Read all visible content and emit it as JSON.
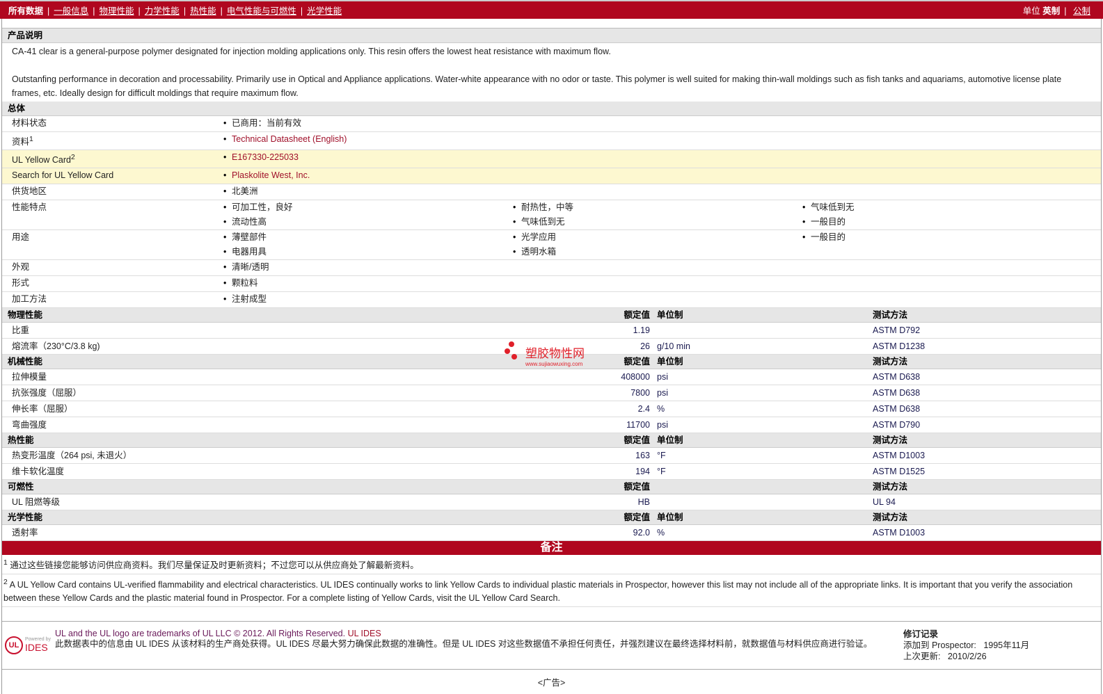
{
  "nav": {
    "active": "所有数据",
    "links": [
      "一般信息",
      "物理性能",
      "力学性能",
      "热性能",
      "电气性能与可燃性",
      "光学性能"
    ],
    "unit_label": "单位",
    "unit_english": "英制",
    "unit_metric": "公制"
  },
  "description": {
    "title": "产品说明",
    "p1": "CA-41 clear is a general-purpose polymer designated for injection molding applications only. This resin offers the lowest heat resistance with maximum flow.",
    "p2": "Outstanfing performance in decoration and processability. Primarily use in Optical and Appliance applications. Water-white appearance with no odor or taste. This polymer is well suited for making thin-wall moldings such as fish tanks and aquariams, automotive license plate frames, etc. Ideally design for difficult moldings that require maximum flow."
  },
  "general": {
    "title": "总体",
    "rows": [
      {
        "label": "材料状态",
        "values": [
          "已商用：当前有效"
        ]
      },
      {
        "label": "资料",
        "sup": "1",
        "values": [
          "Technical Datasheet (English)"
        ],
        "link": true
      },
      {
        "label": "UL Yellow Card",
        "sup": "2",
        "values": [
          "E167330-225033"
        ],
        "link": true,
        "yellow": true
      },
      {
        "label": "Search for UL Yellow Card",
        "values": [
          "Plaskolite West, Inc."
        ],
        "link": true,
        "yellow": true
      },
      {
        "label": "供货地区",
        "values": [
          "北美洲"
        ]
      },
      {
        "label": "性能特点",
        "values": [
          "可加工性，良好",
          "耐热性，中等",
          "气味低到无",
          "流动性高",
          "气味低到无",
          "一般目的"
        ]
      },
      {
        "label": "用途",
        "values": [
          "薄壁部件",
          "光学应用",
          "一般目的",
          "电器用具",
          "透明水箱"
        ]
      },
      {
        "label": "外观",
        "values": [
          "清晰/透明"
        ]
      },
      {
        "label": "形式",
        "values": [
          "颗粒料"
        ]
      },
      {
        "label": "加工方法",
        "values": [
          "注射成型"
        ]
      }
    ]
  },
  "headers": {
    "nominal": "额定值",
    "unit": "单位制",
    "test": "测试方法"
  },
  "sections": [
    {
      "title": "物理性能",
      "unit": true,
      "rows": [
        [
          "比重",
          "1.19",
          "",
          "ASTM D792"
        ],
        [
          "熔流率（230°C/3.8 kg)",
          "26",
          "g/10 min",
          "ASTM D1238"
        ]
      ]
    },
    {
      "title": "机械性能",
      "unit": true,
      "rows": [
        [
          "拉伸模量",
          "408000",
          "psi",
          "ASTM D638"
        ],
        [
          "抗张强度（屈服）",
          "7800",
          "psi",
          "ASTM D638"
        ],
        [
          "伸长率（屈服）",
          "2.4",
          "%",
          "ASTM D638"
        ],
        [
          "弯曲强度",
          "11700",
          "psi",
          "ASTM D790"
        ]
      ]
    },
    {
      "title": "热性能",
      "unit": true,
      "rows": [
        [
          "热变形温度（264 psi, 未退火）",
          "163",
          "°F",
          "ASTM D1003"
        ],
        [
          "维卡软化温度",
          "194",
          "°F",
          "ASTM D1525"
        ]
      ]
    },
    {
      "title": "可燃性",
      "unit": false,
      "rows": [
        [
          "UL 阻燃等级",
          "HB",
          "",
          "UL 94"
        ]
      ]
    },
    {
      "title": "光学性能",
      "unit": true,
      "rows": [
        [
          "透射率",
          "92.0",
          "%",
          "ASTM D1003"
        ]
      ]
    }
  ],
  "watermark": {
    "text": "塑胶物性网",
    "url": "www.sujiaowuxing.com"
  },
  "notes": {
    "title": "备注",
    "n1": "通过这些链接您能够访问供应商资料。我们尽量保证及时更新资料；不过您可以从供应商处了解最新资料。",
    "n2": "A UL Yellow Card contains UL-verified flammability and electrical characteristics. UL IDES continually works to link Yellow Cards to individual plastic materials in Prospector, however this list may not include all of the appropriate links. It is important that you verify the association between these Yellow Cards and the plastic material found in Prospector. For a complete listing of Yellow Cards, visit the UL Yellow Card Search."
  },
  "footer": {
    "logo_ul": "UL",
    "logo_powered": "Powered by",
    "logo_ides": "IDES",
    "line1": "UL and the UL logo are trademarks of UL LLC © 2012. All Rights Reserved.",
    "line1_link": "UL IDES",
    "line2": "此数据表中的信息由 UL IDES 从该材料的生产商处获得。UL IDES 尽最大努力确保此数据的准确性。但是 UL IDES 对这些数据值不承担任何责任，并强烈建议在最终选择材料前，就数据值与材料供应商进行验证。",
    "rev_title": "修订记录",
    "added_label": "添加到 Prospector:",
    "added": "1995年11月",
    "updated_label": "上次更新:",
    "updated": "2010/2/26",
    "ad": "<广告>"
  }
}
